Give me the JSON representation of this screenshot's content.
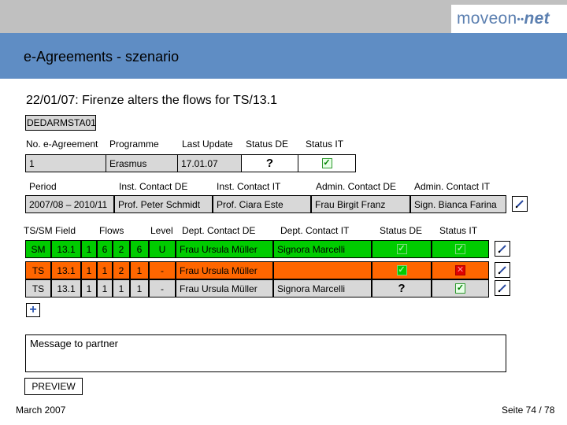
{
  "brand": {
    "logo_main": "moveon",
    "logo_dots": "••",
    "logo_net": "net"
  },
  "title": "e-Agreements - szenario",
  "scenario": "22/01/07: Firenze alters the flows for TS/13.1",
  "agreement_code": "DEDARMSTA01",
  "agreement_headers": {
    "no": "No. e-Agreement",
    "programme": "Programme",
    "last_update": "Last Update",
    "status_de": "Status DE",
    "status_it": "Status IT"
  },
  "agreement_row": {
    "no": "1",
    "programme": "Erasmus",
    "last_update": "17.01.07",
    "status_de": "?",
    "status_it": "checked"
  },
  "period_headers": {
    "period": "Period",
    "inst_de": "Inst. Contact DE",
    "inst_it": "Inst. Contact IT",
    "admin_de": "Admin. Contact DE",
    "admin_it": "Admin. Contact IT"
  },
  "period_row": {
    "period": "2007/08 – 2010/11",
    "inst_de": "Prof. Peter Schmidt",
    "inst_it": "Prof. Ciara Este",
    "admin_de": "Frau Birgit Franz",
    "admin_it": "Sign. Bianca Farina"
  },
  "flow_headers": {
    "ts_field": "TS/SM Field",
    "flows": "Flows",
    "level": "Level",
    "dept_de": "Dept. Contact DE",
    "dept_it": "Dept. Contact IT",
    "status_de": "Status DE",
    "status_it": "Status IT"
  },
  "flow_rows": [
    {
      "type": "SM",
      "field": "13.1",
      "f1": "1",
      "f2": "6",
      "f3": "2",
      "f4": "6",
      "level": "U",
      "dept_de": "Frau Ursula Müller",
      "dept_it": "Signora Marcelli",
      "status_de": "checked",
      "status_it": "checked",
      "color": "#00cc00"
    },
    {
      "type": "TS",
      "field": "13.1",
      "f1": "1",
      "f2": "1",
      "f3": "2",
      "f4": "1",
      "level": "-",
      "dept_de": "Frau Ursula Müller",
      "dept_it": "",
      "status_de": "checked",
      "status_it": "rejected",
      "color": "#ff6600"
    },
    {
      "type": "TS",
      "field": "13.1",
      "f1": "1",
      "f2": "1",
      "f3": "1",
      "f4": "1",
      "level": "-",
      "dept_de": "Frau Ursula Müller",
      "dept_it": "Signora Marcelli",
      "status_de": "?",
      "status_it": "checked",
      "color": "#d8d8d8"
    }
  ],
  "add_label": "+",
  "message_placeholder": "Message to partner",
  "preview_label": "PREVIEW",
  "footer": {
    "date": "March 2007",
    "page": "Seite 74 / 78"
  },
  "colors": {
    "title_bar": "#5f8dc4",
    "top_bar": "#c0c0c0",
    "approved_row": "#00cc00",
    "changed_row": "#ff6600",
    "pending_row": "#d8d8d8"
  }
}
